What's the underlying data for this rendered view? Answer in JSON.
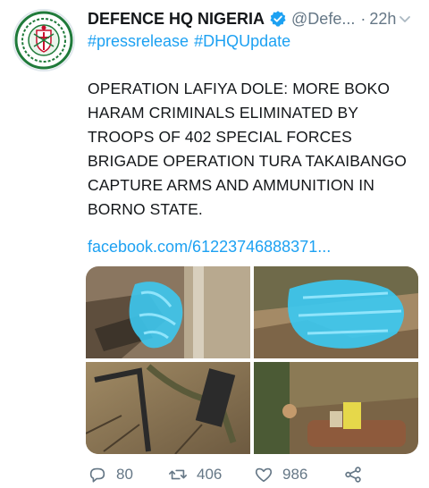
{
  "tweet": {
    "display_name": "DEFENCE HQ NIGERIA",
    "handle": "@Defe...",
    "separator": "·",
    "time": "22h",
    "hashtags": [
      "#pressrelease",
      "#DHQUpdate"
    ],
    "text": "OPERATION LAFIYA DOLE: MORE BOKO HARAM CRIMINALS ELIMINATED BY TROOPS OF 402 SPECIAL FORCES BRIGADE OPERATION TURA TAKAIBANGO CAPTURE ARMS AND AMMUNITION IN BORNO STATE.",
    "link": "facebook.com/61223746888371..."
  },
  "actions": {
    "reply_count": "80",
    "retweet_count": "406",
    "like_count": "986"
  },
  "icons": {
    "avatar": "defence-hq-crest-icon",
    "verified": "verified-badge-icon",
    "menu": "chevron-down-icon",
    "reply": "reply-icon",
    "retweet": "retweet-icon",
    "like": "heart-icon",
    "share": "share-icon"
  },
  "colors": {
    "accent": "#1da1f2",
    "muted": "#657786",
    "text": "#14171a",
    "crest_green": "#1f7a3a",
    "crest_red": "#c8102e",
    "redaction_cyan": "#3cc8f0"
  }
}
